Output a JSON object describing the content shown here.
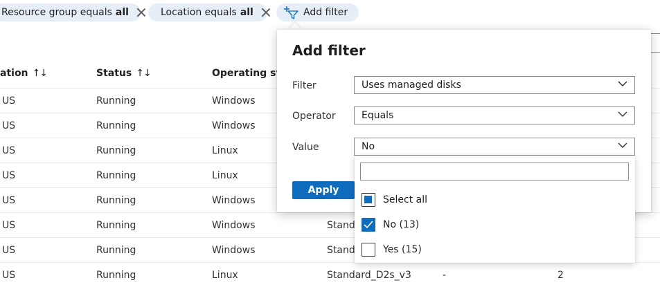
{
  "filters": {
    "pills": [
      {
        "prefix": "Resource group equals",
        "value": "all"
      },
      {
        "prefix": "Location equals",
        "value": "all"
      }
    ],
    "add_label": "Add filter"
  },
  "table": {
    "headers": [
      {
        "label": "ation",
        "sort": "↑↓"
      },
      {
        "label": "Status",
        "sort": "↑↓"
      },
      {
        "label": "Operating syst"
      }
    ],
    "rows": [
      {
        "loc": "US",
        "status": "Running",
        "os": "Windows",
        "size": "",
        "c5": "",
        "c6": ""
      },
      {
        "loc": "US",
        "status": "Running",
        "os": "Windows",
        "size": "",
        "c5": "",
        "c6": ""
      },
      {
        "loc": "US",
        "status": "Running",
        "os": "Linux",
        "size": "",
        "c5": "",
        "c6": ""
      },
      {
        "loc": "US",
        "status": "Running",
        "os": "Linux",
        "size": "",
        "c5": "",
        "c6": ""
      },
      {
        "loc": "US",
        "status": "Running",
        "os": "Windows",
        "size": "",
        "c5": "",
        "c6": ""
      },
      {
        "loc": "US",
        "status": "Running",
        "os": "Windows",
        "size": "Standa",
        "c5": "",
        "c6": ""
      },
      {
        "loc": "US",
        "status": "Running",
        "os": "Windows",
        "size": "Standa",
        "c5": "",
        "c6": ""
      },
      {
        "loc": "US",
        "status": "Running",
        "os": "Linux",
        "size": "Standard_D2s_v3",
        "c5": "-",
        "c6": "2"
      }
    ]
  },
  "dialog": {
    "title": "Add filter",
    "filter_label": "Filter",
    "filter_value": "Uses managed disks",
    "operator_label": "Operator",
    "operator_value": "Equals",
    "value_label": "Value",
    "value_value": "No",
    "apply_label": "Apply",
    "options": [
      {
        "label": "Select all",
        "state": "partial"
      },
      {
        "label": "No (13)",
        "state": "checked"
      },
      {
        "label": "Yes (15)",
        "state": "unchecked"
      }
    ]
  },
  "colors": {
    "accent": "#0f6cbd",
    "pill_bg": "#e6eef8"
  }
}
